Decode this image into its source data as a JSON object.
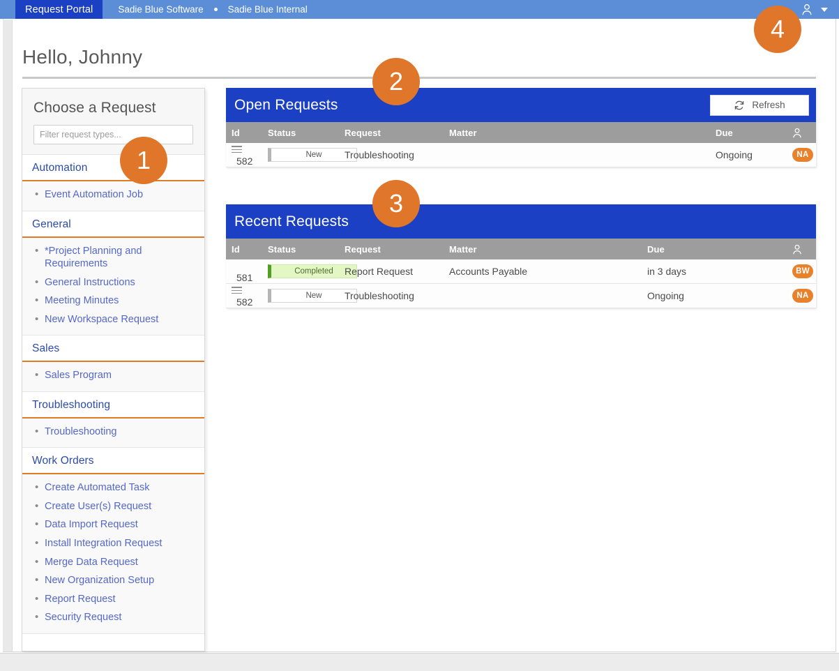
{
  "navbar": {
    "active_tab": "Request Portal",
    "links": [
      "Sadie Blue Software",
      "Sadie Blue Internal"
    ],
    "user_icon": "user-icon",
    "caret_icon": "chevron-down-icon"
  },
  "page": {
    "greeting": "Hello, Johnny"
  },
  "sidebar": {
    "title": "Choose a Request",
    "filter_placeholder": "Filter request types...",
    "filter_value": "",
    "sections": [
      {
        "header": "Automation",
        "items": [
          "Event Automation Job"
        ]
      },
      {
        "header": "General",
        "items": [
          "*Project Planning and Requirements",
          "General Instructions",
          "Meeting Minutes",
          "New Workspace Request"
        ]
      },
      {
        "header": "Sales",
        "items": [
          "Sales Program"
        ]
      },
      {
        "header": "Troubleshooting",
        "items": [
          "Troubleshooting"
        ]
      },
      {
        "header": "Work Orders",
        "items": [
          "Create Automated Task",
          "Create User(s) Request",
          "Data Import Request",
          "Install Integration Request",
          "Merge Data Request",
          "New Organization Setup",
          "Report Request",
          "Security Request"
        ]
      }
    ]
  },
  "open_requests": {
    "title": "Open Requests",
    "refresh_label": "Refresh",
    "refresh_icon": "refresh-icon",
    "columns": [
      "Id",
      "Status",
      "Request",
      "Matter",
      "Due",
      "assignee-icon"
    ],
    "rows": [
      {
        "menu": "row-menu-icon",
        "id": "582",
        "status": "New",
        "status_kind": "new",
        "request": "Troubleshooting",
        "matter": "",
        "due": "Ongoing",
        "assignee": "NA"
      }
    ]
  },
  "recent_requests": {
    "title": "Recent Requests",
    "columns": [
      "Id",
      "Status",
      "Request",
      "Matter",
      "Due",
      "assignee-icon"
    ],
    "rows": [
      {
        "menu": "",
        "id": "581",
        "status": "Completed",
        "status_kind": "completed",
        "request": "Report Request",
        "matter": "Accounts Payable",
        "due": "in 3 days",
        "assignee": "BW"
      },
      {
        "menu": "row-menu-icon",
        "id": "582",
        "status": "New",
        "status_kind": "new",
        "request": "Troubleshooting",
        "matter": "",
        "due": "Ongoing",
        "assignee": "NA"
      }
    ]
  },
  "callouts": [
    {
      "number": "1"
    },
    {
      "number": "2"
    },
    {
      "number": "3"
    },
    {
      "number": "4"
    }
  ],
  "colors": {
    "nav_bg": "#5b8ed6",
    "nav_active": "#1b40c4",
    "panel_header": "#1b40c4",
    "table_header": "#9d9d9d",
    "accent_orange": "#e0762a",
    "link_blue": "#5468c9",
    "section_blue": "#2b4ba8",
    "completed_green": "#4ea020"
  }
}
